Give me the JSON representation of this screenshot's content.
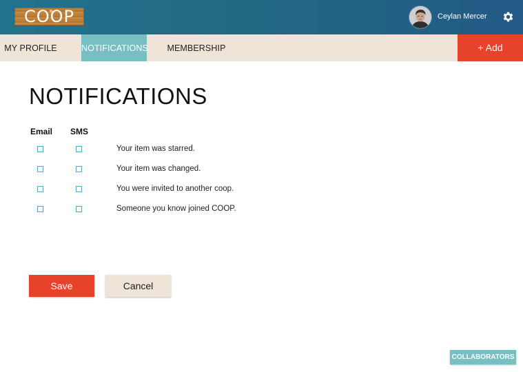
{
  "header": {
    "logo_text": "COOP",
    "user_name": "Ceylan Mercer",
    "settings_icon": "gear-icon",
    "avatar_icon": "avatar"
  },
  "tabs": [
    {
      "label": "MY PROFILE",
      "active": false
    },
    {
      "label": "NOTIFICATIONS",
      "active": true
    },
    {
      "label": "MEMBERSHIP",
      "active": false
    }
  ],
  "add_button": {
    "label": "+ Add"
  },
  "page": {
    "title": "NOTIFICATIONS",
    "columns": {
      "email": "Email",
      "sms": "SMS"
    },
    "rows": [
      {
        "label": "Your item was starred.",
        "email": false,
        "sms": false
      },
      {
        "label": "Your item was changed.",
        "email": false,
        "sms": false
      },
      {
        "label": "You were invited to another coop.",
        "email": false,
        "sms": false
      },
      {
        "label": "Someone you know joined COOP.",
        "email": false,
        "sms": false
      }
    ]
  },
  "actions": {
    "save_label": "Save",
    "cancel_label": "Cancel"
  },
  "collaborators": {
    "label": "COLLABORATORS"
  },
  "colors": {
    "header_teal": "#216983",
    "tab_bar": "#efe4d8",
    "active_tab": "#77bfc3",
    "accent_red": "#e7432a",
    "checkbox_border": "#5aa6bc"
  }
}
